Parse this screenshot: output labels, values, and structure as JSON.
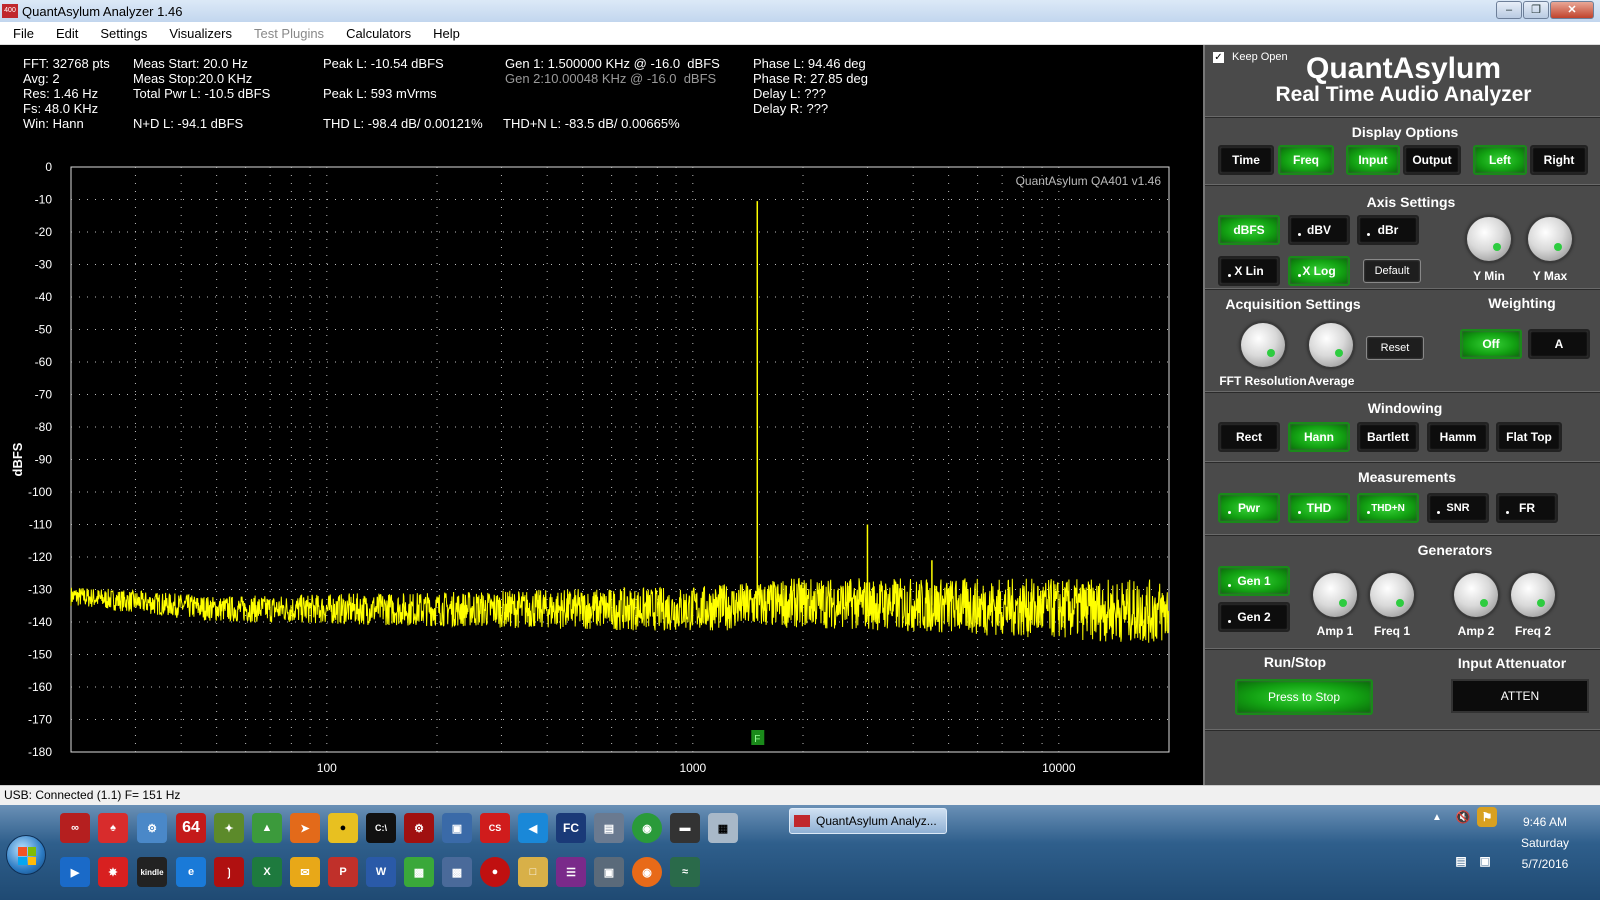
{
  "window": {
    "title": "QuantAsylum Analyzer 1.46",
    "icon_text": "400"
  },
  "menu": [
    {
      "label": "File",
      "enabled": true
    },
    {
      "label": "Edit",
      "enabled": true
    },
    {
      "label": "Settings",
      "enabled": true
    },
    {
      "label": "Visualizers",
      "enabled": true
    },
    {
      "label": "Test Plugins",
      "enabled": false
    },
    {
      "label": "Calculators",
      "enabled": true
    },
    {
      "label": "Help",
      "enabled": true
    }
  ],
  "readouts": {
    "fft": "FFT: 32768 pts",
    "avg": "Avg: 2",
    "res": "Res: 1.46 Hz",
    "fs": "Fs: 48.0 KHz",
    "win": "Win: Hann",
    "meas_start": "Meas Start: 20.0 Hz",
    "meas_stop": "Meas Stop:20.0 KHz",
    "total_pwr": "Total Pwr L: -10.5 dBFS",
    "nd": "N+D L: -94.1 dBFS",
    "peak_dbfs": "Peak L: -10.54 dBFS",
    "peak_mv": "Peak L: 593 mVrms",
    "thd": "THD L: -98.4 dB/ 0.00121%",
    "gen1": "Gen 1: 1.500000 KHz @ -16.0  dBFS",
    "gen2": "Gen 2:10.00048 KHz @ -16.0  dBFS",
    "thdn": "THD+N L: -83.5 dB/ 0.00665%",
    "phase_l": "Phase L: 94.46 deg",
    "phase_r": "Phase R: 27.85 deg",
    "delay_l": "Delay L: ???",
    "delay_r": "Delay R: ???"
  },
  "chart_data": {
    "type": "line",
    "watermark": "QuantAsylum QA401 v1.46",
    "ylabel": "dBFS",
    "xlabel": "",
    "x_scale": "log",
    "xlim": [
      20,
      20000
    ],
    "ylim": [
      -180,
      0
    ],
    "y_ticks": [
      "0",
      "-10",
      "-20",
      "-30",
      "-40",
      "-50",
      "-60",
      "-70",
      "-80",
      "-90",
      "-100",
      "-110",
      "-120",
      "-130",
      "-140",
      "-150",
      "-160",
      "-170",
      "-180"
    ],
    "x_ticks": [
      "100",
      "1000",
      "10000"
    ],
    "grid": true,
    "marker_label": "F",
    "marker_x": 1500,
    "series": [
      {
        "color": "#ffff00",
        "noise_floor": [
          {
            "x": 20,
            "y": -132
          },
          {
            "x": 50,
            "y": -136
          },
          {
            "x": 100,
            "y": -136
          },
          {
            "x": 300,
            "y": -136
          },
          {
            "x": 1000,
            "y": -136
          },
          {
            "x": 2000,
            "y": -134
          },
          {
            "x": 5000,
            "y": -135
          },
          {
            "x": 10000,
            "y": -136
          },
          {
            "x": 20000,
            "y": -137
          }
        ],
        "peaks": [
          {
            "x": 1500,
            "y": -10.5
          },
          {
            "x": 3000,
            "y": -110
          },
          {
            "x": 4500,
            "y": -121
          }
        ]
      }
    ]
  },
  "panel": {
    "keep_open": "Keep Open",
    "brand_title": "QuantAsylum",
    "brand_subtitle": "Real Time Audio Analyzer",
    "display_options": {
      "title": "Display Options",
      "buttons": [
        "Time",
        "Freq",
        "Input",
        "Output",
        "Left",
        "Right"
      ]
    },
    "axis_settings": {
      "title": "Axis Settings",
      "buttons": [
        "dBFS",
        "dBV",
        "dBr",
        "X Lin",
        "X Log",
        "Default"
      ],
      "knobs": [
        "Y Min",
        "Y Max"
      ]
    },
    "acquisition": {
      "title": "Acquisition Settings",
      "knobs": [
        "FFT Resolution",
        "Average"
      ],
      "reset": "Reset"
    },
    "weighting": {
      "title": "Weighting",
      "buttons": [
        "Off",
        "A"
      ]
    },
    "windowing": {
      "title": "Windowing",
      "buttons": [
        "Rect",
        "Hann",
        "Bartlett",
        "Hamm",
        "Flat Top"
      ]
    },
    "measurements": {
      "title": "Measurements",
      "buttons": [
        "Pwr",
        "THD",
        "THD+N",
        "SNR",
        "FR"
      ]
    },
    "generators": {
      "title": "Generators",
      "buttons": [
        "Gen 1",
        "Gen 2"
      ],
      "knobs": [
        "Amp 1",
        "Freq 1",
        "Amp 2",
        "Freq 2"
      ]
    },
    "run_stop": {
      "title": "Run/Stop",
      "button": "Press to Stop"
    },
    "input_atten": {
      "title": "Input Attenuator",
      "button": "ATTEN"
    }
  },
  "status": {
    "text": "USB: Connected  (1.1)  F= 151 Hz"
  },
  "taskbar": {
    "task_label": "QuantAsylum Analyz...",
    "time": "9:46 AM",
    "day": "Saturday",
    "date": "5/7/2016",
    "icon_64": "64"
  },
  "colors": {
    "trace": "#ffff00",
    "active": "#13a313",
    "panel": "#4a4a4a",
    "grid": "#cccccc"
  }
}
